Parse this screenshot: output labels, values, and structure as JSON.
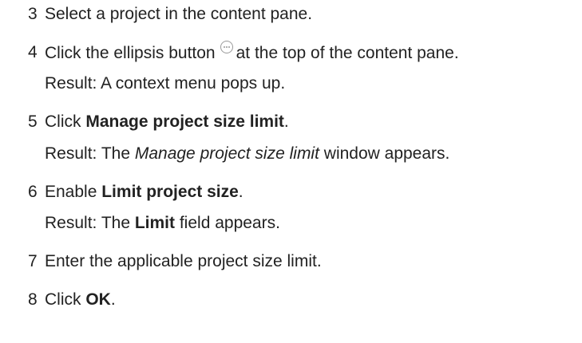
{
  "steps": [
    {
      "number": "3",
      "text": "Select a project in the content pane."
    },
    {
      "number": "4",
      "text_before": "Click the ellipsis button",
      "icon": "ellipsis-icon",
      "text_after": "at the top of the content pane.",
      "result": "Result: A context menu pops up."
    },
    {
      "number": "5",
      "prefix": "Click ",
      "bold": "Manage project size limit",
      "suffix": ".",
      "result_prefix": "Result: The ",
      "result_italic": "Manage project size limit",
      "result_suffix": " window appears."
    },
    {
      "number": "6",
      "prefix": "Enable ",
      "bold": "Limit project size",
      "suffix": ".",
      "result_prefix": "Result: The ",
      "result_bold": "Limit",
      "result_suffix": " field appears."
    },
    {
      "number": "7",
      "text": "Enter the applicable project size limit."
    },
    {
      "number": "8",
      "prefix": "Click ",
      "bold": "OK",
      "suffix": "."
    }
  ]
}
